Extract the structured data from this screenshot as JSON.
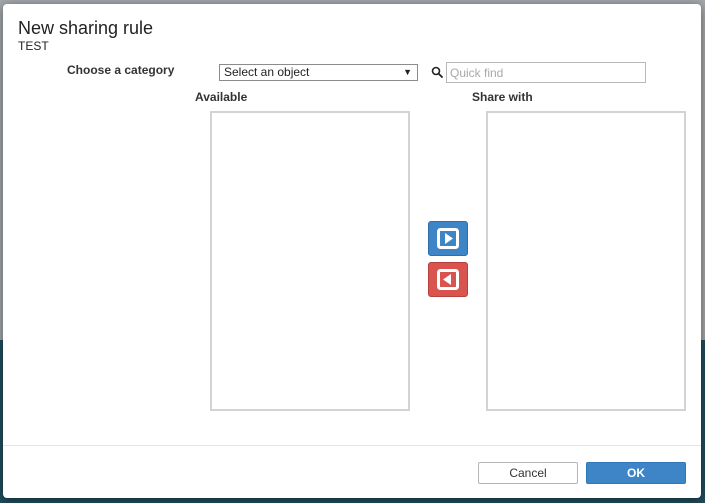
{
  "dialog": {
    "title": "New sharing rule",
    "subtitle": "TEST"
  },
  "filters": {
    "category_label": "Choose a category",
    "object_select_value": "Select an object",
    "quick_find_placeholder": "Quick find"
  },
  "lists": {
    "available_label": "Available",
    "share_with_label": "Share with",
    "available_items": [],
    "share_with_items": []
  },
  "icons": {
    "search": "search-icon",
    "move_right": "arrow-right-icon",
    "move_left": "arrow-left-icon",
    "caret": "caret-down-icon"
  },
  "footer": {
    "cancel_label": "Cancel",
    "ok_label": "OK"
  },
  "colors": {
    "primary_blue": "#3d85c6",
    "danger_red": "#d9534f"
  }
}
